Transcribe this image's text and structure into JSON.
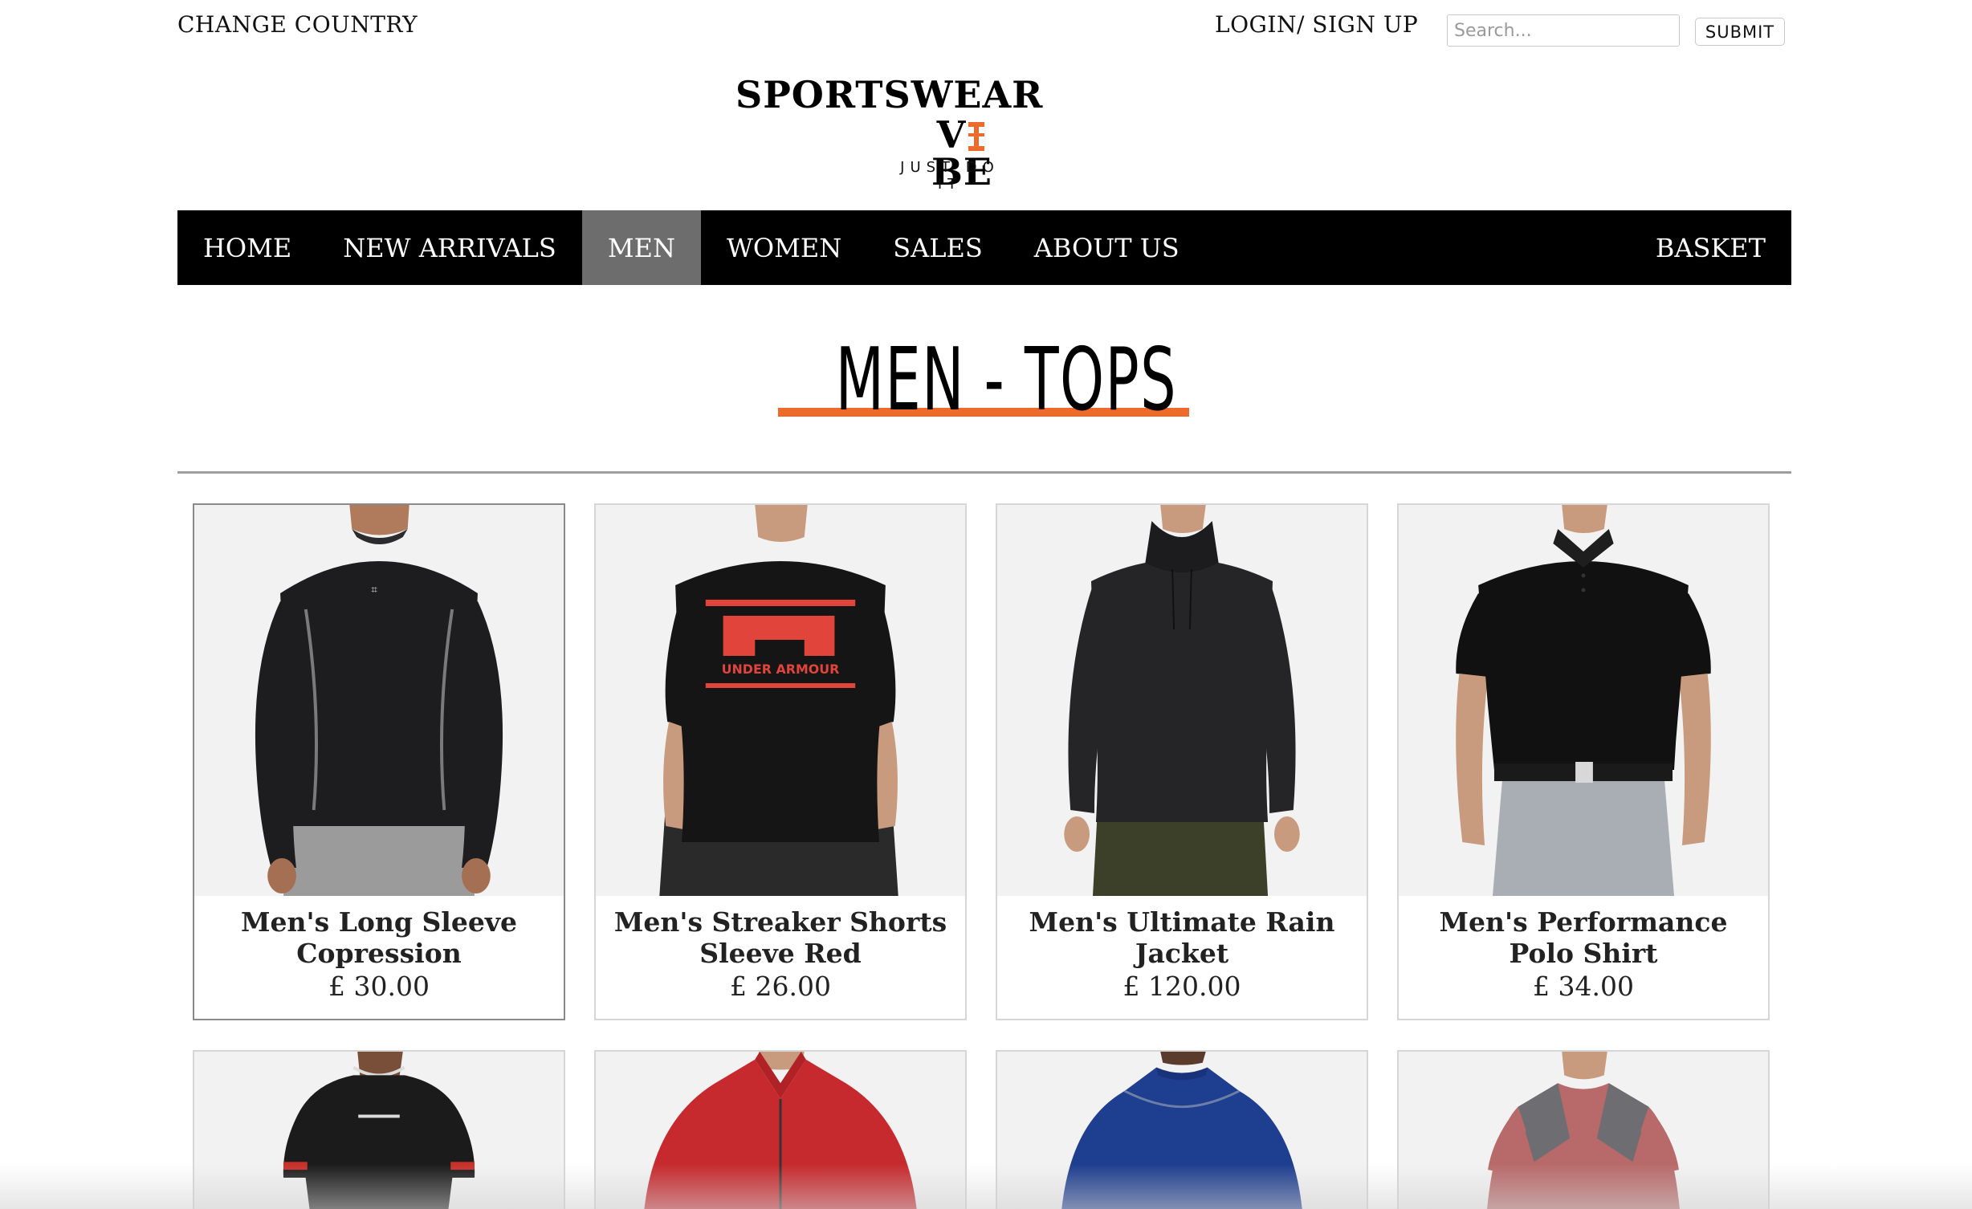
{
  "topbar": {
    "change_country": "CHANGE COUNTRY",
    "login": "LOGIN/ SIGN UP",
    "search_placeholder": "Search...",
    "submit": "SUBMIT"
  },
  "logo": {
    "line1": "SPORTSWEAR",
    "line2_pre": "V",
    "line2_post": "BE",
    "tagline": "JUST DO IT"
  },
  "nav": {
    "items": [
      "HOME",
      "NEW ARRIVALS",
      "MEN",
      "WOMEN",
      "SALES",
      "ABOUT US"
    ],
    "active": "MEN",
    "basket": "BASKET"
  },
  "page": {
    "heading": "MEN - TOPS",
    "accent_color": "#ee6a2a"
  },
  "products": [
    {
      "name": "Men's Long Sleeve Copression",
      "price": "£ 30.00",
      "shirt_color": "#1d1d1f",
      "pants_color": "#9b9b9b"
    },
    {
      "name": "Men's Streaker Shorts Sleeve Red",
      "price": "£ 26.00",
      "shirt_color": "#151515",
      "pants_color": "#2a2a2a",
      "logo_color": "#e0443a"
    },
    {
      "name": "Men's Ultimate Rain Jacket",
      "price": "£ 120.00",
      "shirt_color": "#252527",
      "pants_color": "#3d4028"
    },
    {
      "name": "Men's Performance Polo Shirt",
      "price": "£ 34.00",
      "shirt_color": "#111111",
      "pants_color": "#a9adb4"
    },
    {
      "shirt_color": "#1b1b1b",
      "accent": "#c8302a"
    },
    {
      "shirt_color": "#c62a2e"
    },
    {
      "shirt_color": "#1e3e8f"
    },
    {
      "shirt_color": "#b86a6a"
    }
  ]
}
